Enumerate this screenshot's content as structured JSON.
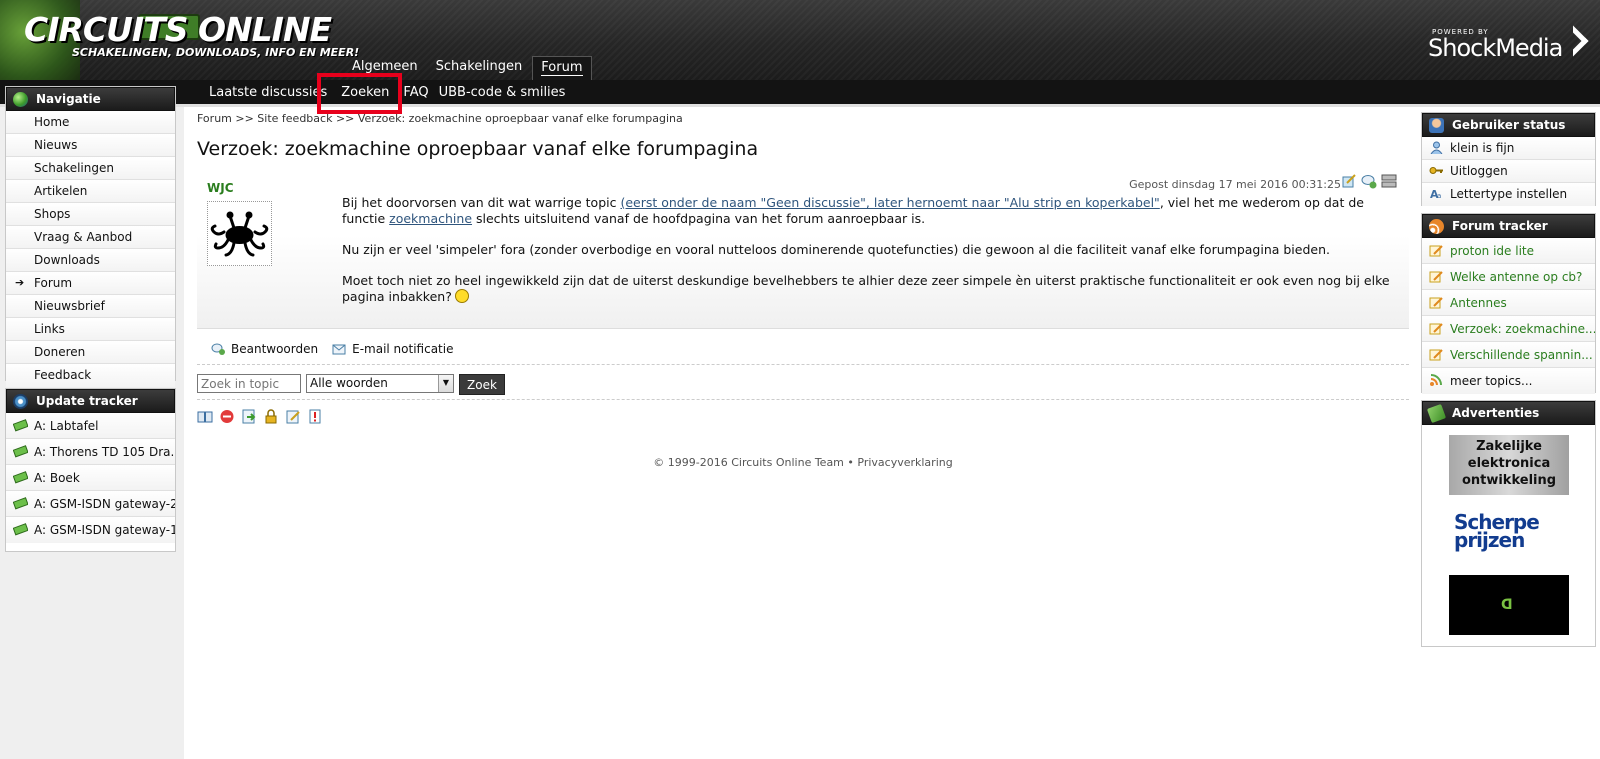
{
  "colors": {
    "accent_green": "#2a7d1e",
    "highlight_red": "#e8001c",
    "link_blue": "#2f557d"
  },
  "header": {
    "logo_title": "CIRCUITS ONLINE",
    "logo_sub": "SCHAKELINGEN, DOWNLOADS, INFO EN MEER!",
    "powered_by": "POWERED BY",
    "brand_name": "ShockMedia"
  },
  "topnav": [
    "Algemeen",
    "Schakelingen",
    "Forum"
  ],
  "subnav": [
    "Laatste discussies",
    "Zoeken",
    "FAQ",
    "UBB-code & smilies"
  ],
  "sidebar": {
    "nav_title": "Navigatie",
    "nav": [
      "Home",
      "Nieuws",
      "Schakelingen",
      "Artikelen",
      "Shops",
      "Vraag & Aanbod",
      "Downloads",
      "Forum",
      "Nieuwsbrief",
      "Links",
      "Doneren",
      "Feedback"
    ],
    "update_title": "Update tracker",
    "updates": [
      "A: Labtafel",
      "A: Thorens TD 105 Dra...",
      "A: Boek",
      "A: GSM-ISDN gateway-2",
      "A: GSM-ISDN gateway-1"
    ]
  },
  "main": {
    "breadcrumb": "Forum >> Site feedback >> Verzoek: zoekmachine oproepbaar vanaf elke forumpagina",
    "title": "Verzoek: zoekmachine oproepbaar vanaf elke forumpagina",
    "post": {
      "author": "WJC",
      "meta": "Gepost dinsdag 17 mei 2016 00:31:25",
      "p1_a": "Bij het doorvorsen van dit wat warrige topic ",
      "p1_link": "(eerst onder de naam \"Geen discussie\", later hernoemt naar \"Alu strip en koperkabel\"",
      "p1_b": ", viel het me wederom op dat de functie ",
      "p1_link2": "zoekmachine",
      "p1_c": " slechts uitsluitend vanaf de hoofdpagina van het forum aanroepbaar is.",
      "p2": "Nu zijn er veel 'simpeler' fora (zonder overbodige en vooral nutteloos dominerende quotefuncties) die gewoon al die faciliteit vanaf elke forumpagina bieden.",
      "p3": "Moet toch niet zo heel ingewikkeld zijn dat de uiterst deskundige bevelhebbers te alhier deze zeer simpele èn uiterst praktische functionaliteit er ook even nog bij elke pagina inbakken?"
    },
    "actions": {
      "reply": "Beantwoorden",
      "notify": "E-mail notificatie"
    },
    "search": {
      "placeholder": "Zoek in topic",
      "mode": "Alle woorden",
      "button": "Zoek"
    },
    "footer": "© 1999-2016 Circuits Online Team • Privacyverklaring"
  },
  "right": {
    "status_title": "Gebruiker status",
    "status_items": [
      "klein is fijn",
      "Uitloggen",
      "Lettertype instellen"
    ],
    "tracker_title": "Forum tracker",
    "tracker_items": [
      "proton ide lite",
      "Welke antenne op cb?",
      "Antennes",
      "Verzoek: zoekmachine...",
      "Verschillende spannin..."
    ],
    "tracker_more": "meer topics...",
    "ads_title": "Advertenties",
    "ad1": "Zakelijke elektronica ontwikkeling",
    "ad2_line1": "Scherpe",
    "ad2_line2": "prijzen"
  }
}
